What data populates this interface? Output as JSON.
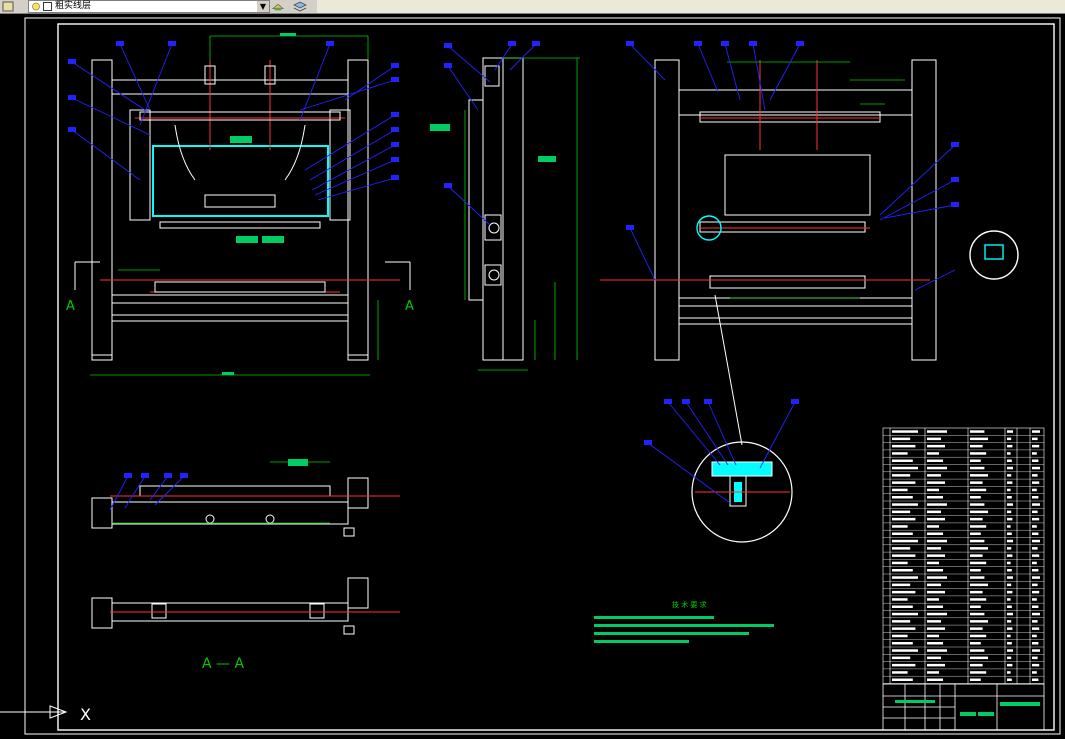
{
  "toolbar": {
    "layer_name": "粗实线层",
    "dropdown_arrow": "▼",
    "icons": [
      "layer-state-icon",
      "layer-freeze-icon",
      "layer-color-icon",
      "layer-previous-icon",
      "layer-stack-icon"
    ]
  },
  "drawing": {
    "section_label_left": "A",
    "section_label_right": "A",
    "section_view_title": "A — A",
    "ucs_label": "X",
    "tech_requirements_title": "技 术 要 求",
    "colors": {
      "background": "#000000",
      "outline": "#ffffff",
      "leader": "#2222ff",
      "dimension": "#00cc00",
      "center": "#ff3333",
      "hatch": "#00ffff",
      "balloon": "#00cc66"
    }
  }
}
